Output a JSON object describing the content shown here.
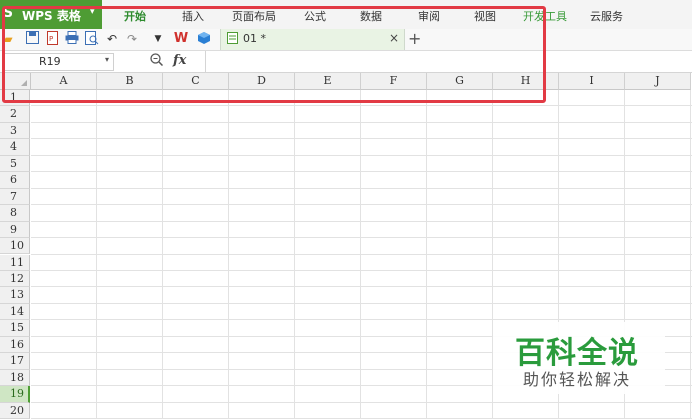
{
  "app": {
    "logo": "S",
    "name": "WPS 表格",
    "caret": "▾",
    "brand_color": "#4e9c34"
  },
  "menu": [
    {
      "label": "开始",
      "active": true
    },
    {
      "label": "插入"
    },
    {
      "label": "页面布局"
    },
    {
      "label": "公式"
    },
    {
      "label": "数据"
    },
    {
      "label": "审阅"
    },
    {
      "label": "视图"
    },
    {
      "label": "开发工具"
    },
    {
      "label": "云服务"
    }
  ],
  "toolbar": {
    "icons": [
      "open-folder-icon",
      "save-icon",
      "export-pdf-icon",
      "print-icon",
      "print-preview-icon",
      "undo-icon",
      "redo-icon",
      "customize-dropdown-icon",
      "wps-logo-icon",
      "cube-icon"
    ],
    "tab": {
      "name": "01 *",
      "close": "×"
    },
    "new_tab": "+"
  },
  "formula_bar": {
    "name_box": "R19",
    "fx": "fx",
    "formula": ""
  },
  "grid": {
    "columns": [
      "A",
      "B",
      "C",
      "D",
      "E",
      "F",
      "G",
      "H",
      "I",
      "J"
    ],
    "rows": [
      "1",
      "2",
      "3",
      "4",
      "5",
      "6",
      "7",
      "8",
      "9",
      "10",
      "11",
      "12",
      "13",
      "14",
      "15",
      "16",
      "17",
      "18",
      "19",
      "20"
    ],
    "selected_row": "19"
  },
  "highlight_color": "#e23a44",
  "watermark": {
    "title": "百科全说",
    "subtitle": "助你轻松解决"
  }
}
